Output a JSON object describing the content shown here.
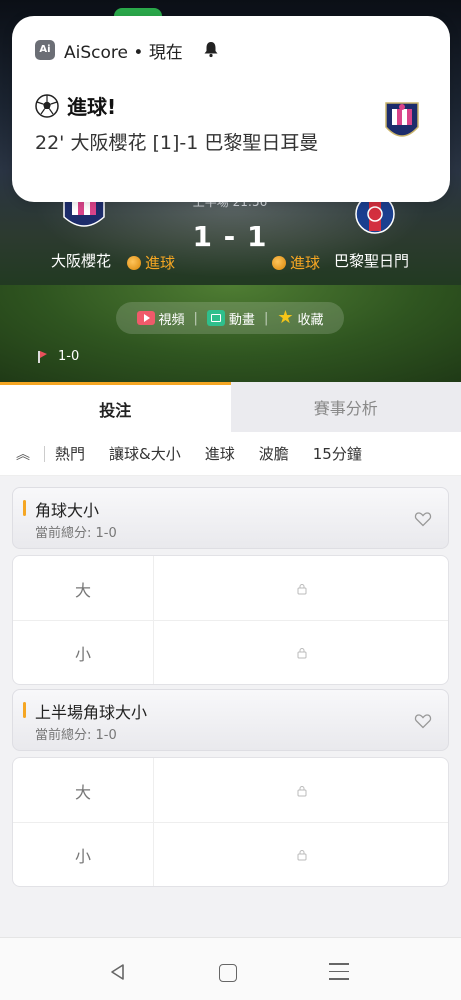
{
  "notification": {
    "app_name": "AiScore",
    "time": "現在",
    "title": "進球!",
    "body": "22' 大阪櫻花 [1]-1 巴黎聖日耳曼",
    "icons": [
      "app-icon",
      "bell-icon",
      "soccer-ball-icon",
      "team-crest-icon"
    ]
  },
  "match": {
    "half_time_label": "上半場",
    "clock": "21:56",
    "score": "1 - 1",
    "home_team": "大阪櫻花",
    "away_team": "巴黎聖日門",
    "home_goal_label": "進球",
    "away_goal_label": "進球",
    "corner_score": "1-0"
  },
  "media": {
    "video_label": "視頻",
    "animation_label": "動畫",
    "favorite_label": "收藏"
  },
  "tabs": {
    "main": [
      "投注",
      "賽事分析"
    ],
    "sub": [
      "熱門",
      "讓球&大小",
      "進球",
      "波膽",
      "15分鐘"
    ]
  },
  "markets": [
    {
      "name": "角球大小",
      "current": "當前總分: 1-0",
      "rows": [
        "大",
        "小"
      ]
    },
    {
      "name": "上半場角球大小",
      "current": "當前總分: 1-0",
      "rows": [
        "大",
        "小"
      ]
    }
  ],
  "colors": {
    "accent": "#f5a623",
    "goal_text": "#f5a623",
    "video_icon": "#ef5a6a",
    "animation_icon": "#2fbf8c",
    "star": "#f5c518"
  }
}
